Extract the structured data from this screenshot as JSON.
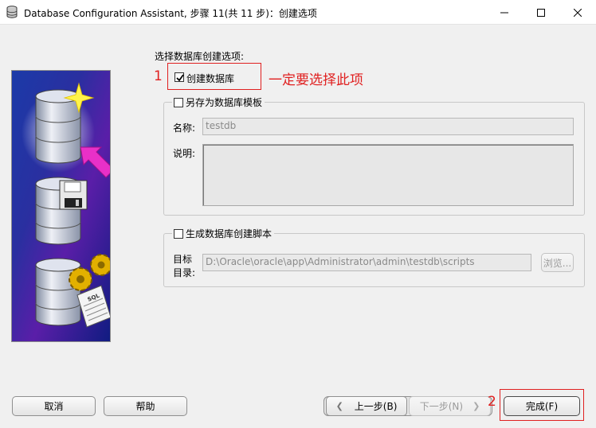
{
  "window": {
    "title": "Database Configuration Assistant, 步骤 11(共 11 步)：创建选项"
  },
  "main": {
    "prompt": "选择数据库创建选项:",
    "create_db": {
      "label": "创建数据库",
      "checked": true
    },
    "template_group": {
      "label": "另存为数据库模板",
      "checked": false,
      "name_label": "名称:",
      "name_value": "testdb",
      "desc_label": "说明:",
      "desc_value": ""
    },
    "script_group": {
      "label": "生成数据库创建脚本",
      "checked": false,
      "dest_label_1": "目标",
      "dest_label_2": "目录:",
      "dest_value": "D:\\Oracle\\oracle\\app\\Administrator\\admin\\testdb\\scripts",
      "browse_label": "浏览..."
    }
  },
  "footer": {
    "cancel": "取消",
    "help": "帮助",
    "back": "上一步(B)",
    "next": "下一步(N)",
    "finish": "完成(F)"
  },
  "annotations": {
    "n1": "1",
    "n2": "2",
    "note": "一定要选择此项",
    "color": "#e02020"
  },
  "sidebar_image": {
    "label": "SQL",
    "icons": [
      "database-star-icon",
      "database-floppy-icon",
      "database-gears-script-icon"
    ]
  }
}
